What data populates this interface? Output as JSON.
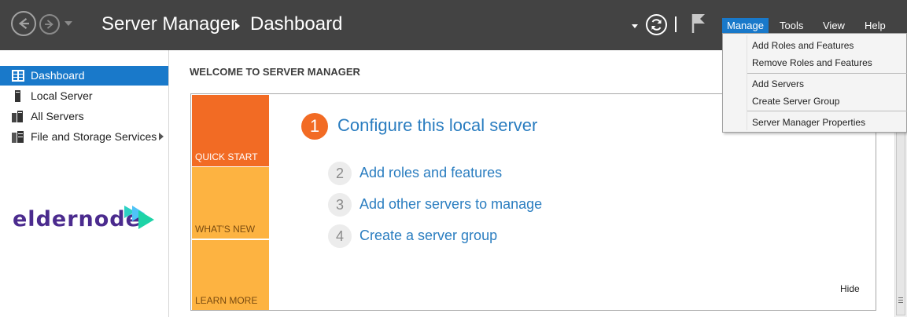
{
  "titlebar": {
    "breadcrumb": [
      "Server Manager",
      "Dashboard"
    ],
    "menu": [
      "Manage",
      "Tools",
      "View",
      "Help"
    ],
    "active_menu": "Manage",
    "icons": [
      "back-arrow-icon",
      "forward-arrow-icon",
      "refresh-icon",
      "flag-icon"
    ]
  },
  "manage_menu": {
    "items": [
      "Add Roles and Features",
      "Remove Roles and Features",
      "Add Servers",
      "Create Server Group",
      "Server Manager Properties"
    ]
  },
  "sidebar": {
    "items": [
      {
        "label": "Dashboard",
        "icon": "dashboard-icon",
        "active": true
      },
      {
        "label": "Local Server",
        "icon": "server-icon"
      },
      {
        "label": "All Servers",
        "icon": "servers-icon"
      },
      {
        "label": "File and Storage Services",
        "icon": "storage-icon",
        "has_submenu": true
      }
    ],
    "logo": "eldernode"
  },
  "main": {
    "heading": "WELCOME TO SERVER MANAGER",
    "tiles": [
      "QUICK START",
      "WHAT'S NEW",
      "LEARN MORE"
    ],
    "steps": [
      {
        "num": "1",
        "label": "Configure this local server"
      },
      {
        "num": "2",
        "label": "Add roles and features"
      },
      {
        "num": "3",
        "label": "Add other servers to manage"
      },
      {
        "num": "4",
        "label": "Create a server group"
      }
    ],
    "hide_label": "Hide"
  },
  "colors": {
    "titlebar": "#434343",
    "accent_blue": "#1979ca",
    "quick_start": "#f26b24",
    "tile_yellow": "#fdb341",
    "link_blue": "#2a7dc0"
  }
}
